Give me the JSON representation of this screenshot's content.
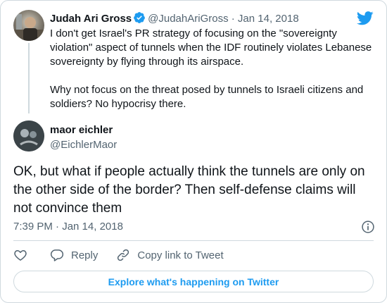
{
  "colors": {
    "accent": "#1d9bf0",
    "text": "#0f1419",
    "muted": "#536471",
    "border": "#cfd9de"
  },
  "parent_tweet": {
    "author_name": "Judah Ari Gross",
    "verified_icon": "verified-badge-icon",
    "handle": "@JudahAriGross",
    "separator": "·",
    "date": "Jan 14, 2018",
    "paragraph_1": "I don't get Israel's PR strategy of focusing on the \"sovereignty violation\" aspect of tunnels when the IDF routinely violates Lebanese sovereignty by flying through its airspace.",
    "paragraph_2": "Why not focus on the threat posed by tunnels to Israeli citizens and soldiers? No hypocrisy there."
  },
  "main_tweet": {
    "author_name": "maor eichler",
    "handle": "@EichlerMaor",
    "text": "OK, but what if people actually think the tunnels are only on the other side of the border? Then self-defense claims will not convince them",
    "timestamp": "7:39 PM · Jan 14, 2018"
  },
  "actions": {
    "like_icon": "heart-icon",
    "reply_icon": "reply-icon",
    "reply_label": "Reply",
    "copy_link_icon": "link-icon",
    "copy_link_label": "Copy link to Tweet"
  },
  "explore_label": "Explore what's happening on Twitter",
  "icons": {
    "brand": "twitter-bird-icon",
    "info": "info-icon"
  }
}
